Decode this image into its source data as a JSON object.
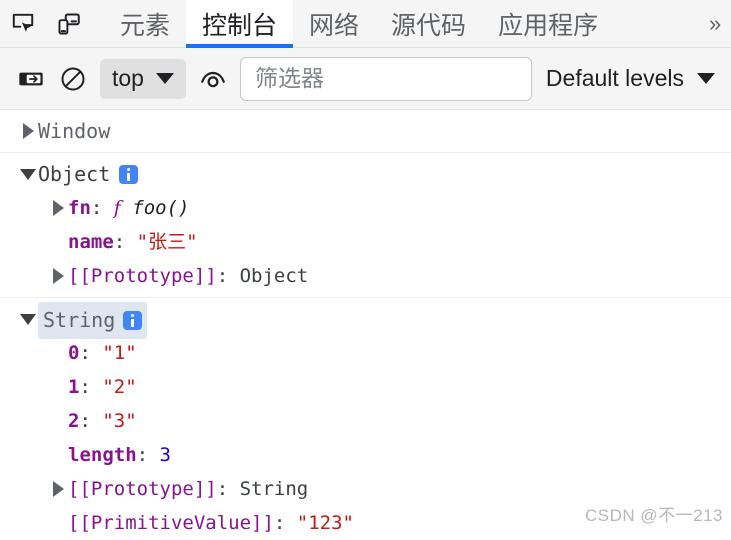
{
  "tabbar": {
    "inspect_icon": "inspect-element-icon",
    "device_icon": "device-toolbar-icon",
    "overflow_label": "»",
    "tabs": [
      {
        "label": "元素",
        "active": false
      },
      {
        "label": "控制台",
        "active": true
      },
      {
        "label": "网络",
        "active": false
      },
      {
        "label": "源代码",
        "active": false
      },
      {
        "label": "应用程序",
        "active": false
      }
    ],
    "active_underline_color": "#1a73e8"
  },
  "toolbar": {
    "sidebar_toggle_icon": "sidebar-toggle-icon",
    "clear_console_icon": "clear-console-icon",
    "context_label": "top",
    "eye_icon": "live-expression-eye-icon",
    "filter_placeholder": "筛选器",
    "filter_value": "",
    "levels_label": "Default levels"
  },
  "console": {
    "messages": [
      {
        "id": "window-message",
        "rows": [
          {
            "indent": 0,
            "arrow": "right",
            "segments": [
              {
                "cls": "node-name",
                "text": "Window"
              }
            ]
          }
        ]
      },
      {
        "id": "object-message",
        "rows": [
          {
            "indent": 0,
            "arrow": "down",
            "selected": false,
            "segments": [
              {
                "cls": "node-name dark",
                "text": "Object"
              },
              {
                "cls": "info",
                "text": "info-badge"
              }
            ]
          },
          {
            "indent": 1,
            "arrow": "right",
            "segments": [
              {
                "cls": "prop-key",
                "text": "fn"
              },
              {
                "cls": "punct",
                "text": ": "
              },
              {
                "cls": "fn-f",
                "text": "f"
              },
              {
                "cls": "punct",
                "text": " "
              },
              {
                "cls": "fn-name",
                "text": "foo()"
              }
            ]
          },
          {
            "indent": 1,
            "arrow": "none",
            "segments": [
              {
                "cls": "prop-key",
                "text": "name"
              },
              {
                "cls": "punct",
                "text": ": "
              },
              {
                "cls": "val-string",
                "text": "\"张三\""
              }
            ]
          },
          {
            "indent": 1,
            "arrow": "right",
            "segments": [
              {
                "cls": "prop-key-internal",
                "text": "[[Prototype]]"
              },
              {
                "cls": "punct",
                "text": ": "
              },
              {
                "cls": "val-object",
                "text": "Object"
              }
            ]
          }
        ]
      },
      {
        "id": "string-message",
        "rows": [
          {
            "indent": 0,
            "arrow": "down",
            "selected": true,
            "segments": [
              {
                "cls": "node-name",
                "text": "String"
              },
              {
                "cls": "info",
                "text": "info-badge"
              }
            ]
          },
          {
            "indent": 1,
            "arrow": "none",
            "segments": [
              {
                "cls": "prop-key",
                "text": "0"
              },
              {
                "cls": "punct",
                "text": ": "
              },
              {
                "cls": "val-string",
                "text": "\"1\""
              }
            ]
          },
          {
            "indent": 1,
            "arrow": "none",
            "segments": [
              {
                "cls": "prop-key",
                "text": "1"
              },
              {
                "cls": "punct",
                "text": ": "
              },
              {
                "cls": "val-string",
                "text": "\"2\""
              }
            ]
          },
          {
            "indent": 1,
            "arrow": "none",
            "segments": [
              {
                "cls": "prop-key",
                "text": "2"
              },
              {
                "cls": "punct",
                "text": ": "
              },
              {
                "cls": "val-string",
                "text": "\"3\""
              }
            ]
          },
          {
            "indent": 1,
            "arrow": "none",
            "segments": [
              {
                "cls": "prop-key",
                "text": "length"
              },
              {
                "cls": "punct",
                "text": ": "
              },
              {
                "cls": "val-number",
                "text": "3"
              }
            ]
          },
          {
            "indent": 1,
            "arrow": "right",
            "segments": [
              {
                "cls": "prop-key-internal",
                "text": "[[Prototype]]"
              },
              {
                "cls": "punct",
                "text": ": "
              },
              {
                "cls": "val-object",
                "text": "String"
              }
            ]
          },
          {
            "indent": 1,
            "arrow": "none",
            "segments": [
              {
                "cls": "prop-key-internal",
                "text": "[[PrimitiveValue]]"
              },
              {
                "cls": "punct",
                "text": ": "
              },
              {
                "cls": "val-string",
                "text": "\"123\""
              }
            ]
          }
        ]
      }
    ]
  },
  "watermark": "CSDN @不一213",
  "colors": {
    "accent": "#1a73e8",
    "info_badge": "#4285f4",
    "string_value": "#c41a16",
    "number_value": "#1c00cf",
    "property_key": "#881391",
    "selection": "#dfe6ef"
  }
}
